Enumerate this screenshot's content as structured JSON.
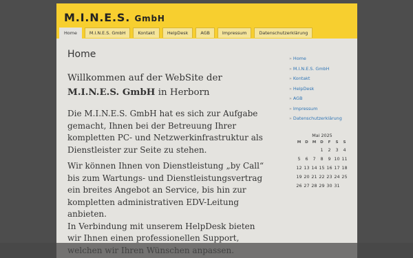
{
  "site": {
    "title_prefix": "M.I.N.E.S. ",
    "title_suffix": "GmbH"
  },
  "nav": [
    {
      "label": "Home",
      "active": true
    },
    {
      "label": "M.I.N.E.S. GmbH"
    },
    {
      "label": "Kontakt"
    },
    {
      "label": "HelpDesk"
    },
    {
      "label": "AGB"
    },
    {
      "label": "Impressum"
    },
    {
      "label": "Datenschutzerklärung"
    }
  ],
  "main": {
    "heading": "Home",
    "welcome_pre": "Willkommen auf der WebSite der ",
    "welcome_bold": "M.I.N.E.S. GmbH",
    "welcome_post": " in Herborn",
    "paragraphs": [
      "Die M.I.N.E.S. GmbH hat es sich zur Aufgabe gemacht, Ihnen bei der Betreuung Ihrer kompletten PC- und Netzwerkinfrastruktur als Dienstleister zur Seite zu stehen.",
      "Wir können Ihnen von Dienstleistung „by Call“ bis zum Wartungs- und Dienstleistungsvertrag ein breites Angebot an Service, bis hin zur kompletten administrativen EDV-Leitung anbieten.",
      "In Verbindung mit unserem HelpDesk bieten wir Ihnen einen professionellen Support, welchen wir Ihren Wünschen anpassen."
    ]
  },
  "sidebar": {
    "bullet": "»",
    "links": [
      "Home",
      "M.I.N.E.S. GmbH",
      "Kontakt",
      "HelpDesk",
      "AGB",
      "Impressum",
      "Datenschutzerklärung"
    ]
  },
  "calendar": {
    "caption": "Mai 2025",
    "weekdays": [
      "M",
      "D",
      "M",
      "D",
      "F",
      "S",
      "S"
    ],
    "weeks": [
      [
        "",
        "",
        "",
        "1",
        "2",
        "3",
        "4"
      ],
      [
        "5",
        "6",
        "7",
        "8",
        "9",
        "10",
        "11"
      ],
      [
        "12",
        "13",
        "14",
        "15",
        "16",
        "17",
        "18"
      ],
      [
        "19",
        "20",
        "21",
        "22",
        "23",
        "24",
        "25"
      ],
      [
        "26",
        "27",
        "28",
        "29",
        "30",
        "31",
        ""
      ]
    ]
  },
  "colors": {
    "header": "#f7cf2f",
    "page_bg": "#e4e3df",
    "outer_bg": "#4d4d4d",
    "link": "#2e74b5"
  }
}
